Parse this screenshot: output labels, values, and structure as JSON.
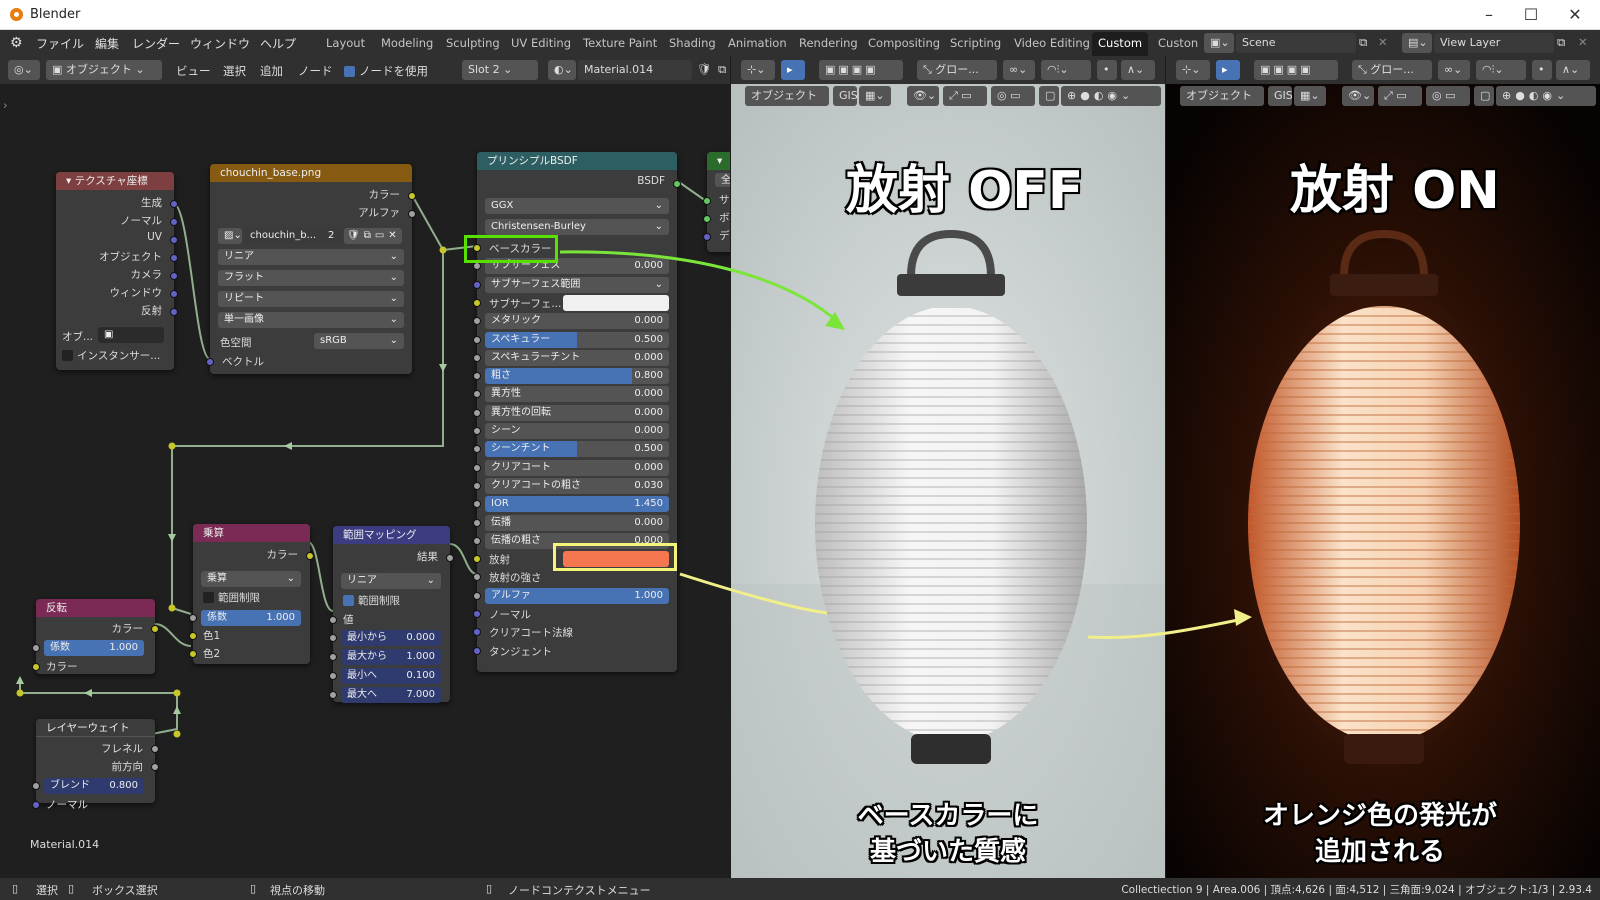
{
  "app": {
    "title": "Blender"
  },
  "menu": [
    "ファイル",
    "編集",
    "レンダー",
    "ウィンドウ",
    "ヘルプ"
  ],
  "workspaces": [
    "Layout",
    "Modeling",
    "Sculpting",
    "UV Editing",
    "Texture Paint",
    "Shading",
    "Animation",
    "Rendering",
    "Compositing",
    "Scripting",
    "Video Editing",
    "Custom",
    "Custon"
  ],
  "active_workspace": "Custom",
  "scene": "Scene",
  "view_layer": "View Layer",
  "node_header": {
    "mode": "オブジェクト",
    "view": "ビュー",
    "select": "選択",
    "add": "追加",
    "node": "ノード",
    "use_nodes": "ノードを使用",
    "slot": "Slot 2",
    "material": "Material.014"
  },
  "viewport_header": {
    "mode": "オブジェクト",
    "gis": "GIS",
    "transform": "グロー..."
  },
  "nodes": {
    "texcoord": {
      "title": "テクスチャ座標",
      "outputs": [
        "生成",
        "ノーマル",
        "UV",
        "オブジェクト",
        "カメラ",
        "ウィンドウ",
        "反射"
      ],
      "object_label": "オブ...",
      "instancer": "インスタンサー..."
    },
    "image": {
      "title": "chouchin_base.png",
      "out_color": "カラー",
      "out_alpha": "アルファ",
      "image_name": "chouchin_b...",
      "users": "2",
      "interp": "リニア",
      "proj": "フラット",
      "ext": "リピート",
      "source": "単一画像",
      "colorspace_label": "色空間",
      "colorspace": "sRGB",
      "in_vector": "ベクトル"
    },
    "bsdf": {
      "title": "プリンシプルBSDF",
      "out": "BSDF",
      "dist": "GGX",
      "sss_method": "Christensen-Burley",
      "rows": [
        {
          "label": "ベースカラー",
          "value": ""
        },
        {
          "label": "サブサーフェス",
          "value": "0.000"
        },
        {
          "label": "サブサーフェス範囲",
          "value": ""
        },
        {
          "label": "サブサーフェ...",
          "value": ""
        },
        {
          "label": "メタリック",
          "value": "0.000"
        },
        {
          "label": "スペキュラー",
          "value": "0.500"
        },
        {
          "label": "スペキュラーチント",
          "value": "0.000"
        },
        {
          "label": "粗さ",
          "value": "0.800"
        },
        {
          "label": "異方性",
          "value": "0.000"
        },
        {
          "label": "異方性の回転",
          "value": "0.000"
        },
        {
          "label": "シーン",
          "value": "0.000"
        },
        {
          "label": "シーンチント",
          "value": "0.500"
        },
        {
          "label": "クリアコート",
          "value": "0.000"
        },
        {
          "label": "クリアコートの粗さ",
          "value": "0.030"
        },
        {
          "label": "IOR",
          "value": "1.450"
        },
        {
          "label": "伝播",
          "value": "0.000"
        },
        {
          "label": "伝播の粗さ",
          "value": "0.000"
        },
        {
          "label": "放射",
          "value": ""
        },
        {
          "label": "放射の強さ",
          "value": ""
        },
        {
          "label": "アルファ",
          "value": "1.000"
        },
        {
          "label": "ノーマル",
          "value": ""
        },
        {
          "label": "クリアコート法線",
          "value": ""
        },
        {
          "label": "タンジェント",
          "value": ""
        }
      ],
      "fills": {
        "スペキュラー": 0.5,
        "粗さ": 0.8,
        "シーンチント": 0.5,
        "IOR": 1.0,
        "アルファ": 1.0
      },
      "emission_color": "#f4774f"
    },
    "output": {
      "outs": [
        "サ",
        "ボ",
        "デ"
      ]
    },
    "multiply": {
      "title": "乗算",
      "out": "カラー",
      "op": "乗算",
      "clamp": "範囲制限",
      "fac_label": "係数",
      "fac": "1.000",
      "c1": "色1",
      "c2": "色2"
    },
    "maprange": {
      "title": "範囲マッピング",
      "out": "結果",
      "interp": "リニア",
      "clamp": "範囲制限",
      "value": "値",
      "fields": [
        {
          "label": "最小から",
          "value": "0.000"
        },
        {
          "label": "最大から",
          "value": "1.000"
        },
        {
          "label": "最小へ",
          "value": "0.100"
        },
        {
          "label": "最大へ",
          "value": "7.000"
        }
      ]
    },
    "invert": {
      "title": "反転",
      "out": "カラー",
      "fac_label": "係数",
      "fac": "1.000",
      "in": "カラー"
    },
    "layerweight": {
      "title": "レイヤーウェイト",
      "fresnel": "フレネル",
      "facing": "前方向",
      "blend_label": "ブレンド",
      "blend": "0.800",
      "normal": "ノーマル"
    }
  },
  "material_label": "Material.014",
  "overlay": {
    "left_title": "放射 OFF",
    "right_title": "放射 ON",
    "left_caption_1": "ベースカラーに",
    "left_caption_2": "基づいた質感",
    "right_caption_1": "オレンジ色の発光が",
    "right_caption_2": "追加される"
  },
  "status": {
    "select": "選択",
    "box_select": "ボックス選択",
    "move_view": "視点の移動",
    "context_menu": "ノードコンテクストメニュー",
    "stats": "Collectiection 9 | Area.006 | 頂点:4,626 | 面:4,512 | 三角面:9,024 | オブジェクト:1/3 | 2.93.4"
  },
  "colors": {
    "node_frame_highlight": "#57e000",
    "emission_highlight": "#f5f37a",
    "arrow_green": "#7be53a",
    "arrow_yellow": "#f1ef8a"
  }
}
